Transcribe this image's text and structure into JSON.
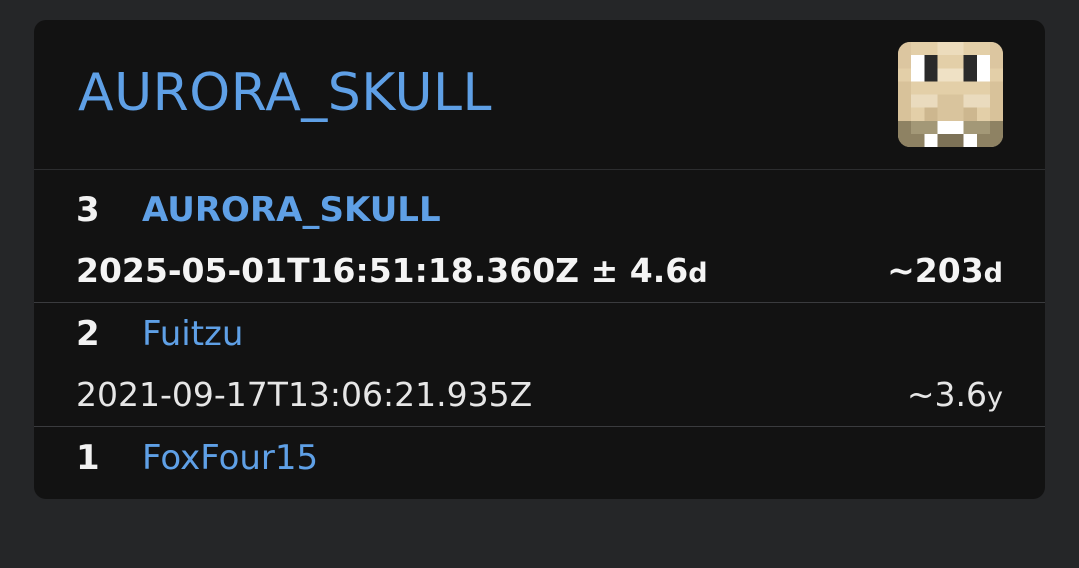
{
  "profile": {
    "title": "AURORA_SKULL",
    "avatar_icon": "player-skin-head-icon"
  },
  "history": [
    {
      "rank": "3",
      "name": "AURORA_SKULL",
      "date": "2025-05-01T16:51:18.360Z ± 4.6",
      "date_unit": "d",
      "age": "~203",
      "age_unit": "d"
    },
    {
      "rank": "2",
      "name": "Fuitzu",
      "date": "2021-09-17T13:06:21.935Z",
      "date_unit": "",
      "age": "~3.6",
      "age_unit": "y"
    },
    {
      "rank": "1",
      "name": "FoxFour15"
    }
  ],
  "colors": {
    "page_background": "#252628",
    "card_background": "#121212",
    "link": "#5fa0e6",
    "text": "#f2f2f2"
  }
}
